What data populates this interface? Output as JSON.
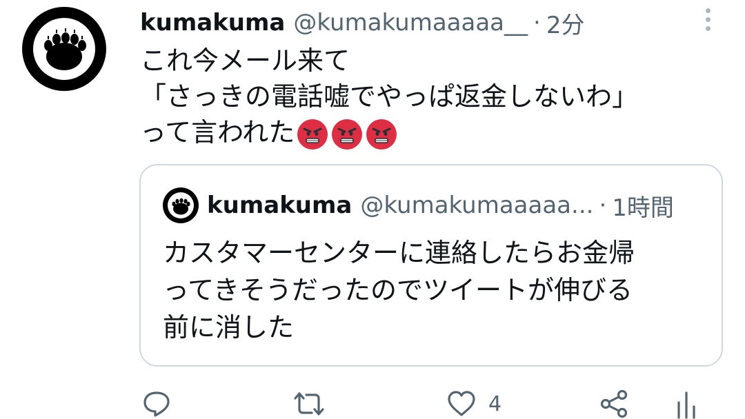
{
  "tweet": {
    "name": "kumakuma",
    "handle": "@kumakumaaaaa__",
    "separator": "·",
    "time": "2分",
    "text": "これ今メール来て\n「さっきの電話嘘でやっぱ返金しないわ」\nって言われた",
    "emojis": [
      "angry-face-emoji",
      "angry-face-emoji",
      "angry-face-emoji"
    ]
  },
  "quoted": {
    "name": "kumakuma",
    "handle": "@kumakumaaaaa...",
    "separator": "·",
    "time": "1時間",
    "text": "カスタマーセンターに連絡したらお金帰\nってきそうだったのでツイートが伸びる\n前に消した"
  },
  "actions": {
    "reply_icon": "reply-icon",
    "retweet_icon": "retweet-icon",
    "like_icon": "heart-icon",
    "like_count": "4",
    "share_icon": "share-icon",
    "analytics_icon": "analytics-icon"
  },
  "colors": {
    "text": "#0f1419",
    "secondary": "#536471",
    "border": "#d0d7de",
    "emoji": "#dd2e44"
  }
}
